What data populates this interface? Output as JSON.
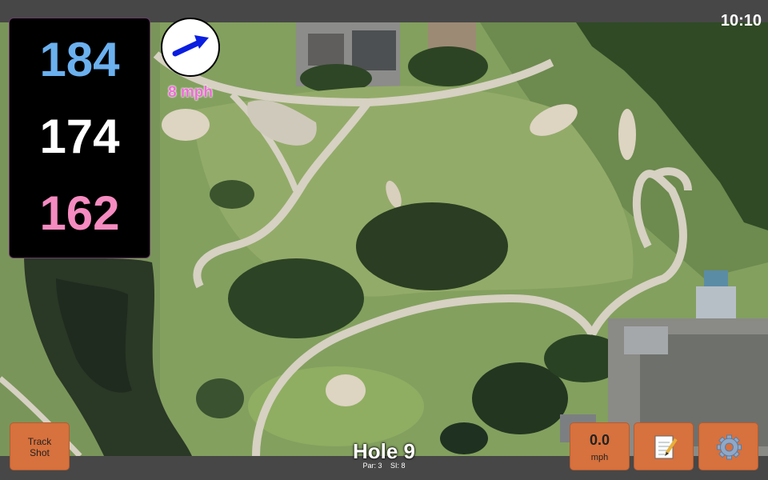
{
  "status_bar": {
    "time": "10:10"
  },
  "distances": {
    "back": "184",
    "middle": "174",
    "front": "162"
  },
  "wind": {
    "speed_label": "8 mph",
    "direction_icon": "arrow-icon"
  },
  "hole": {
    "title": "Hole 9",
    "par_label": "Par: 3",
    "si_label": "SI: 8"
  },
  "buttons": {
    "track_shot_line1": "Track",
    "track_shot_line2": "Shot",
    "speed_value": "0.0",
    "speed_unit": "mph",
    "notes_icon": "notepad-icon",
    "settings_icon": "gear-icon"
  },
  "colors": {
    "back_distance": "#6bb0ef",
    "middle_distance": "#ffffff",
    "front_distance": "#f58bc0",
    "button_bg": "#d7713d",
    "wind_text": "#f06ad7"
  }
}
